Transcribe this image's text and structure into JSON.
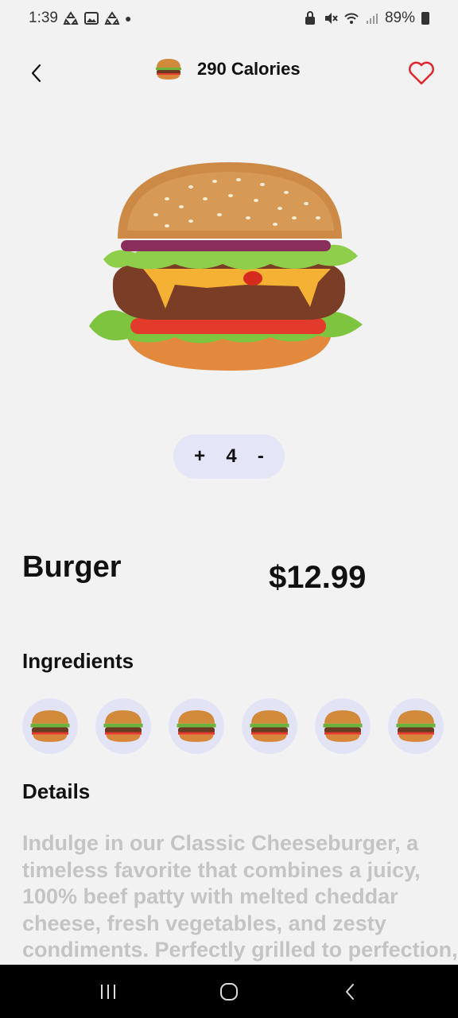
{
  "status_bar": {
    "time": "1:39",
    "battery_text": "89%"
  },
  "header": {
    "calories_label": "290 Calories",
    "back_icon": "chevron-left-icon",
    "favorite_icon": "heart-outline-icon"
  },
  "product": {
    "name": "Burger",
    "price": "$12.99",
    "quantity": "4",
    "increment_label": "+",
    "decrement_label": "-"
  },
  "sections": {
    "ingredients_title": "Ingredients",
    "details_title": "Details"
  },
  "ingredients": [
    "burger",
    "burger",
    "burger",
    "burger",
    "burger",
    "burger"
  ],
  "details": {
    "text": "Indulge in our Classic Cheeseburger, a timeless favorite that combines a juicy, 100% beef patty with melted cheddar cheese, fresh vegetables, and zesty condiments. Perfectly grilled to perfection,"
  },
  "colors": {
    "accent_heart": "#e0262e",
    "stepper_bg": "#e5e5f8",
    "ingredient_bg": "#e3e3f6",
    "details_text": "#c4c4c4"
  }
}
